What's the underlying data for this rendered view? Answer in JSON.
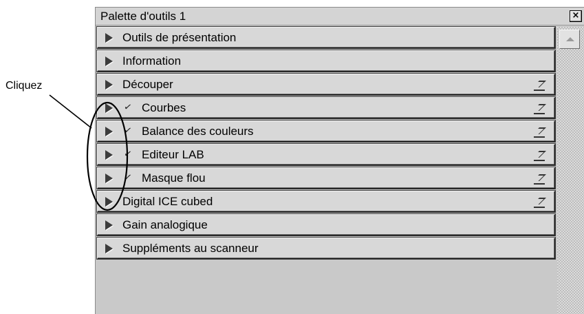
{
  "window": {
    "title": "Palette d'outils 1",
    "close_glyph": "×"
  },
  "palette": {
    "items": [
      {
        "label": "Outils de présentation",
        "sub": false,
        "check": false,
        "collapse_icon": false
      },
      {
        "label": "Information",
        "sub": false,
        "check": false,
        "collapse_icon": false
      },
      {
        "label": "Découper",
        "sub": false,
        "check": false,
        "collapse_icon": true
      },
      {
        "label": "Courbes",
        "sub": true,
        "check": true,
        "collapse_icon": true
      },
      {
        "label": "Balance des couleurs",
        "sub": true,
        "check": true,
        "collapse_icon": true
      },
      {
        "label": "Editeur LAB",
        "sub": true,
        "check": true,
        "collapse_icon": true
      },
      {
        "label": "Masque flou",
        "sub": true,
        "check": true,
        "collapse_icon": true
      },
      {
        "label": "Digital ICE cubed",
        "sub": false,
        "check": false,
        "collapse_icon": true
      },
      {
        "label": "Gain analogique",
        "sub": false,
        "check": false,
        "collapse_icon": false
      },
      {
        "label": "Suppléments au scanneur",
        "sub": false,
        "check": false,
        "collapse_icon": false
      }
    ]
  },
  "annotation": {
    "label": "Cliquez"
  },
  "icons": {
    "expand": "triangle-right-icon",
    "check": "checkmark-icon",
    "collapse": "collapse-panel-icon",
    "scroll_up": "scroll-up-arrow-icon"
  }
}
